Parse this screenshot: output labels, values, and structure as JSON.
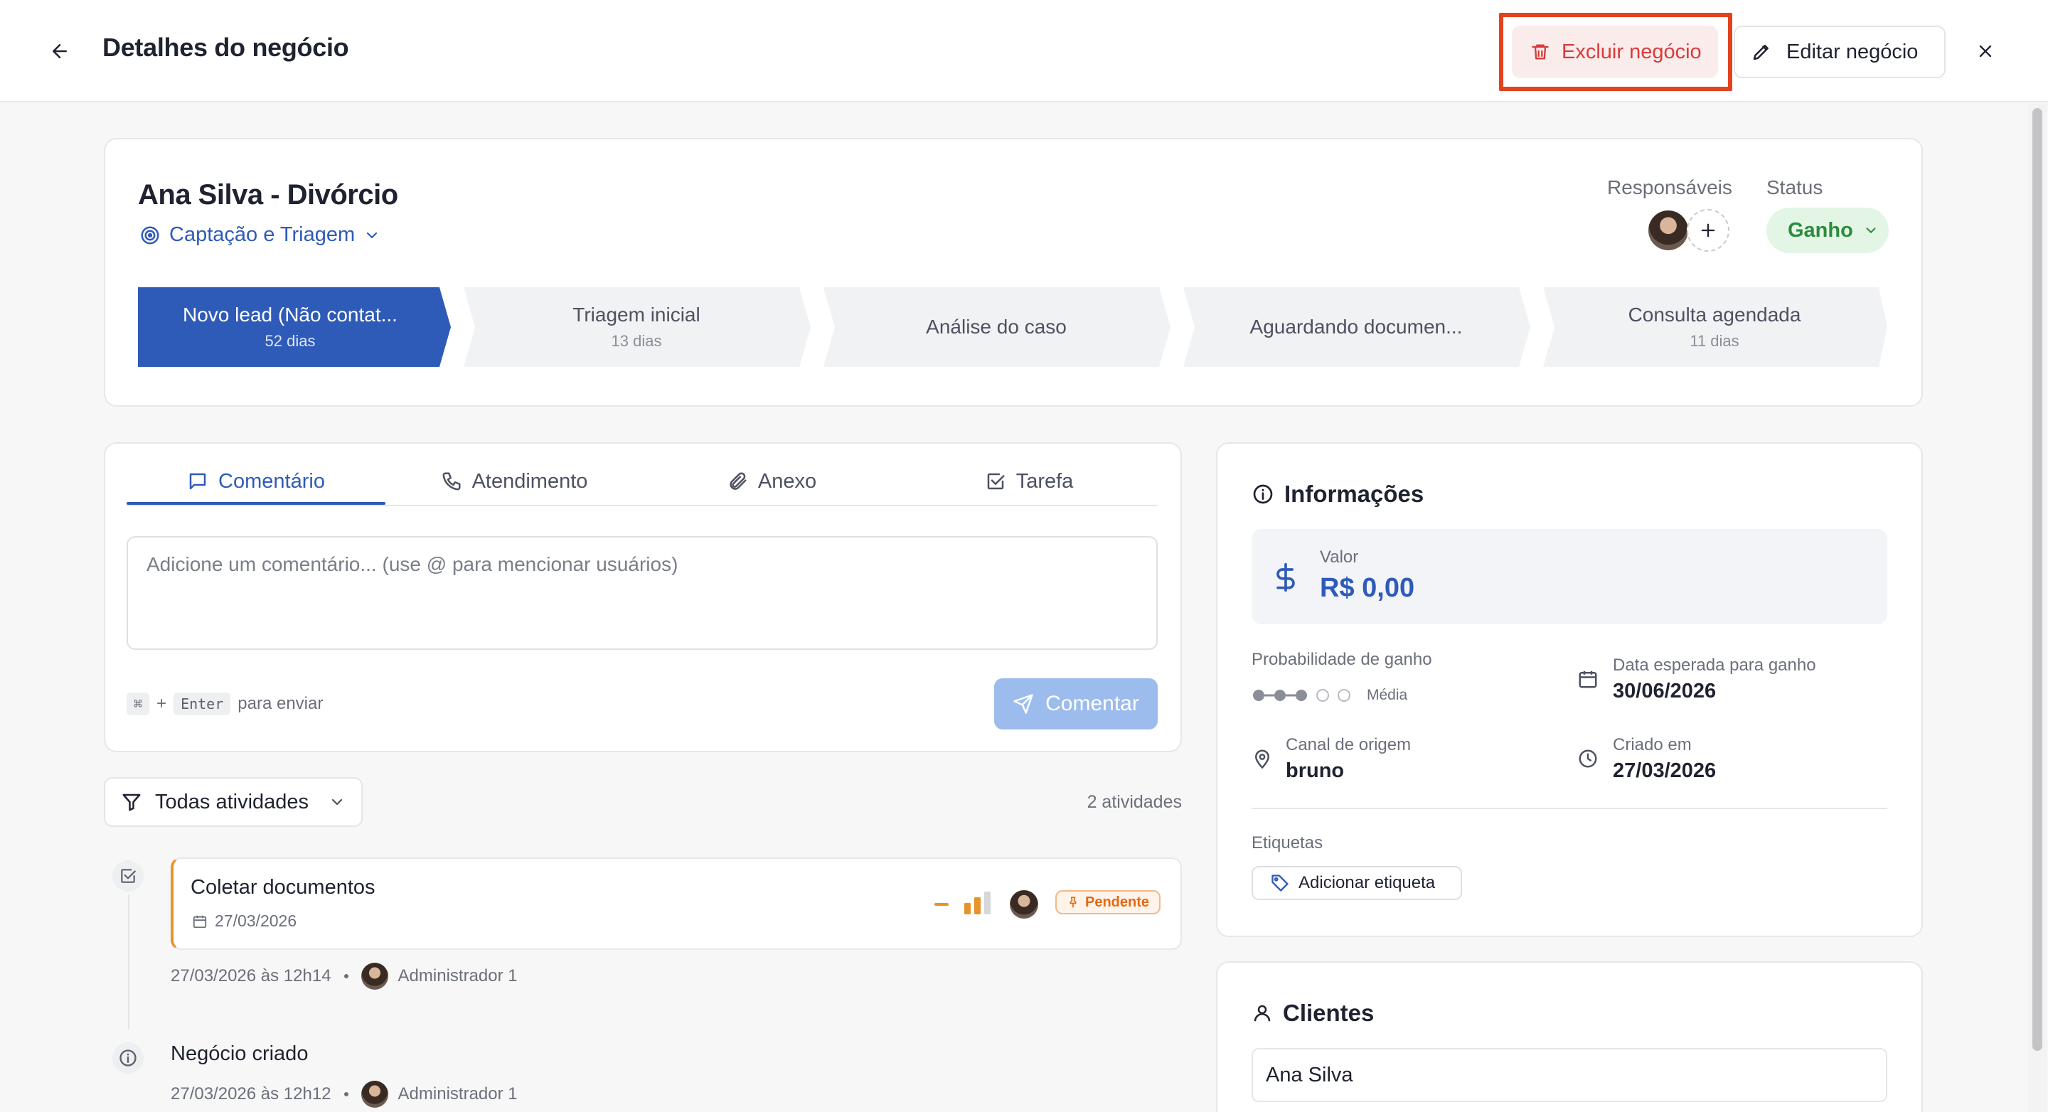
{
  "header": {
    "title": "Detalhes do negócio",
    "delete_label": "Excluir negócio",
    "edit_label": "Editar negócio"
  },
  "deal": {
    "name": "Ana Silva - Divórcio",
    "pipeline": "Captação e Triagem",
    "responsaveis_label": "Responsáveis",
    "status_label": "Status",
    "status_value": "Ganho",
    "stages": [
      {
        "name": "Novo lead (Não contat...",
        "days": "52 dias"
      },
      {
        "name": "Triagem inicial",
        "days": "13 dias"
      },
      {
        "name": "Análise do caso",
        "days": ""
      },
      {
        "name": "Aguardando documen...",
        "days": ""
      },
      {
        "name": "Consulta agendada",
        "days": "11 dias"
      }
    ]
  },
  "composer": {
    "tabs": [
      {
        "label": "Comentário",
        "icon": "message-square-icon"
      },
      {
        "label": "Atendimento",
        "icon": "phone-icon"
      },
      {
        "label": "Anexo",
        "icon": "paperclip-icon"
      },
      {
        "label": "Tarefa",
        "icon": "checkbox-icon"
      }
    ],
    "placeholder": "Adicione um comentário... (use @ para mencionar usuários)",
    "hint_key1": "⌘",
    "hint_plus": "+",
    "hint_key2": "Enter",
    "hint_text": "para enviar",
    "submit_label": "Comentar"
  },
  "activities": {
    "filter_label": "Todas atividades",
    "count": "2 atividades",
    "items": [
      {
        "title": "Coletar documentos",
        "date": "27/03/2026",
        "badge": "Pendente",
        "meta_time": "27/03/2026 às 12h14",
        "author": "Administrador 1"
      },
      {
        "title": "Negócio criado",
        "meta_time": "27/03/2026 às 12h12",
        "author": "Administrador 1"
      }
    ]
  },
  "info": {
    "title": "Informações",
    "value_label": "Valor",
    "value": "R$ 0,00",
    "prob_label": "Probabilidade de ganho",
    "prob_level": "Média",
    "prob_filled": 3,
    "prob_total": 5,
    "expected_label": "Data esperada para ganho",
    "expected_value": "30/06/2026",
    "origin_label": "Canal de origem",
    "origin_value": "bruno",
    "created_label": "Criado em",
    "created_value": "27/03/2026",
    "tags_label": "Etiquetas",
    "add_tag_label": "Adicionar etiqueta"
  },
  "clients": {
    "title": "Clientes",
    "items": [
      "Ana Silva"
    ]
  },
  "colors": {
    "accent": "#2f5bb8",
    "danger": "#d93a3a",
    "success": "#2e8b3d",
    "pending": "#e26a12"
  }
}
